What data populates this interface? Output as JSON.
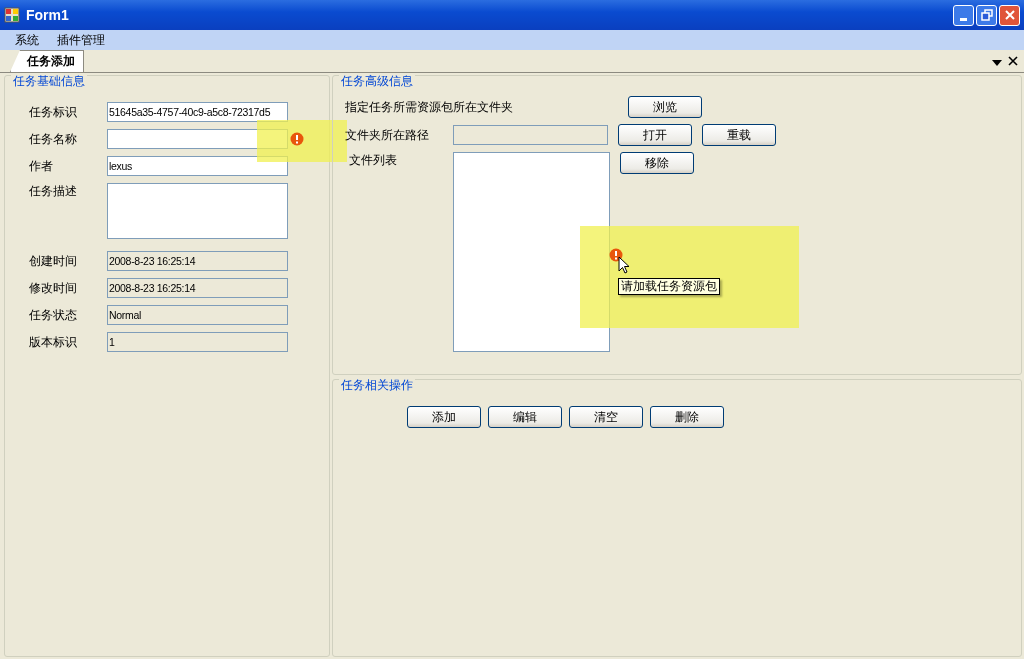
{
  "window": {
    "title": "Form1"
  },
  "menu": [
    {
      "label": "系统"
    },
    {
      "label": "插件管理"
    }
  ],
  "tabs": [
    {
      "label": "任务添加",
      "selected": true
    }
  ],
  "basic_info": {
    "title": "任务基础信息",
    "fields": [
      {
        "label": "任务标识",
        "value": "51645a35-4757-40c9-a5c8-72317d5",
        "kind": "text",
        "readonly": false,
        "error": false
      },
      {
        "label": "任务名称",
        "kind": "text",
        "readonly": false,
        "error": true
      },
      {
        "label": "作者",
        "value": "lexus",
        "kind": "text",
        "readonly": false,
        "error": false
      },
      {
        "label": "任务描述",
        "kind": "multiline",
        "readonly": false,
        "error": false
      },
      {
        "label": "创建时间",
        "value": "2008-8-23 16:25:14",
        "kind": "text",
        "readonly": true,
        "error": false
      },
      {
        "label": "修改时间",
        "value": "2008-8-23 16:25:14",
        "kind": "text",
        "readonly": true,
        "error": false
      },
      {
        "label": "任务状态",
        "value": "Normal",
        "kind": "text",
        "readonly": true,
        "error": false
      },
      {
        "label": "版本标识",
        "value": "1",
        "kind": "text",
        "readonly": true,
        "error": false
      }
    ]
  },
  "advanced_info": {
    "title": "任务高级信息",
    "folder_prompt": "指定任务所需资源包所在文件夹",
    "browse_button": "浏览",
    "path_label": "文件夹所在路径",
    "open_button": "打开",
    "reload_button": "重载",
    "file_list_label": "文件列表",
    "remove_button": "移除",
    "error_tooltip": "请加载任务资源包"
  },
  "operations": {
    "title": "任务相关操作",
    "buttons": [
      "添加",
      "编辑",
      "清空",
      "删除"
    ]
  }
}
